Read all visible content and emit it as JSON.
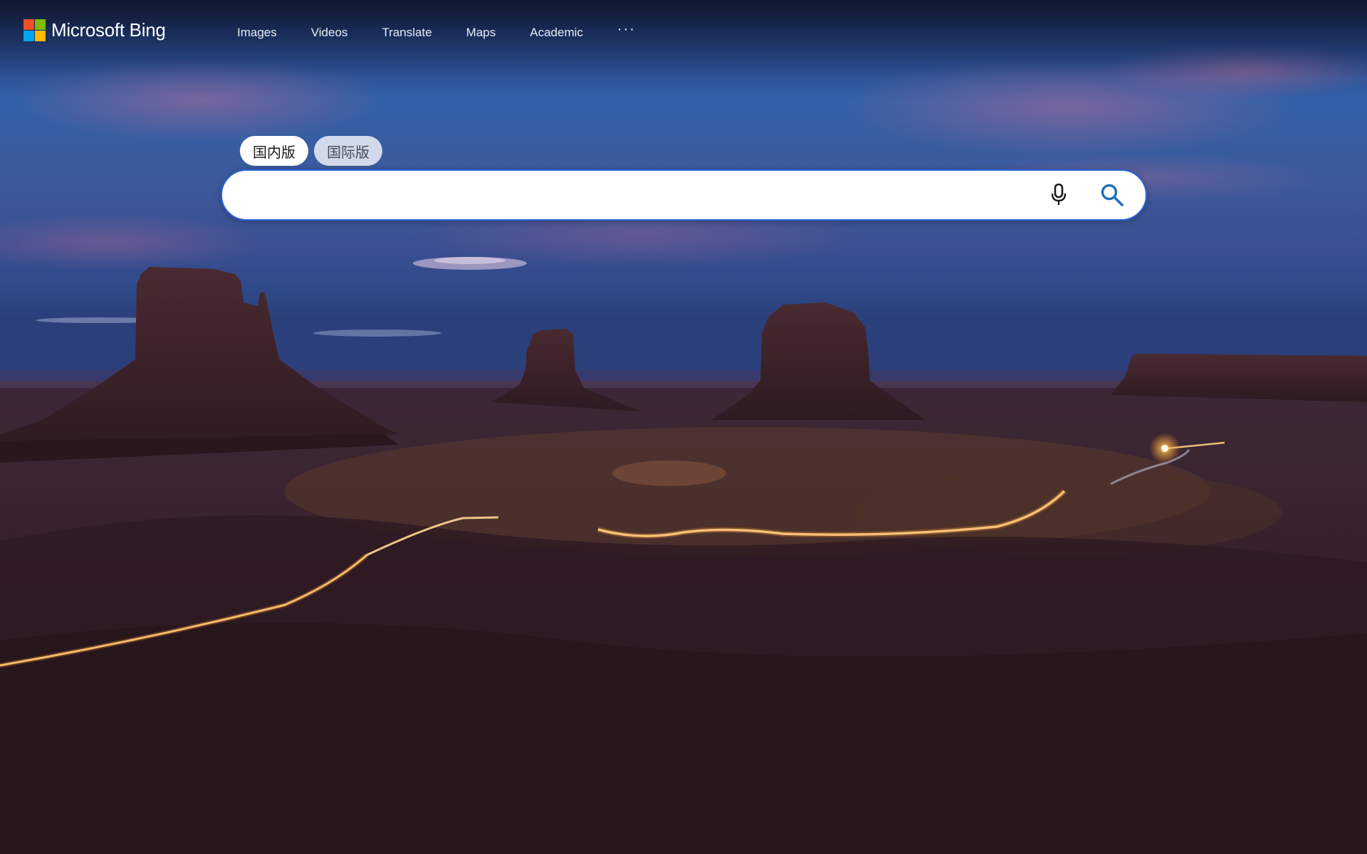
{
  "brand": {
    "name": "Microsoft Bing",
    "logo_colors": [
      "#f25022",
      "#7fba00",
      "#00a4ef",
      "#ffb900"
    ]
  },
  "nav": {
    "items": [
      {
        "label": "Images"
      },
      {
        "label": "Videos"
      },
      {
        "label": "Translate"
      },
      {
        "label": "Maps"
      },
      {
        "label": "Academic"
      }
    ],
    "more_label": "···"
  },
  "region_toggle": {
    "options": [
      {
        "label": "国内版",
        "selected": true
      },
      {
        "label": "国际版",
        "selected": false
      }
    ]
  },
  "search": {
    "value": "",
    "placeholder": "",
    "mic_icon": "microphone-icon",
    "search_icon": "magnifier-icon",
    "border_color": "#2a66d8",
    "search_icon_color": "#1f6fb8"
  },
  "background": {
    "icon": "landscape-photo"
  }
}
